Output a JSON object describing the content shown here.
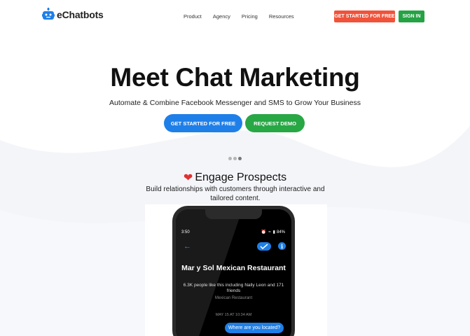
{
  "brand": {
    "name": "eChatbots"
  },
  "nav": {
    "items": [
      "Product",
      "Agency",
      "Pricing",
      "Resources"
    ]
  },
  "header": {
    "cta_label": "GET STARTED FOR FREE",
    "signin_label": "SIGN IN"
  },
  "hero": {
    "title": "Meet Chat Marketing",
    "subtitle": "Automate & Combine Facebook Messenger and SMS to Grow Your Business",
    "primary_cta": "GET STARTED FOR FREE",
    "secondary_cta": "REQUEST DEMO"
  },
  "carousel": {
    "dots": 3,
    "active": 2
  },
  "section": {
    "title": "Engage Prospects",
    "description": "Build relationships with customers through interactive and tailored content."
  },
  "phone": {
    "time": "3:50",
    "battery": "84%",
    "page_name": "Mar y Sol Mexican Restaurant",
    "likes": "6.3K people like this including Nally Leon and 171 friends",
    "category": "Mexican Restaurant",
    "message_time": "MAY 15 AT 10:34 AM",
    "message": "Where are you located?"
  },
  "colors": {
    "orange": "#f0533a",
    "green": "#28a745",
    "blue": "#1f7fe8",
    "heart": "#e03131"
  },
  "icons": [
    "robot-logo-icon",
    "heart-icon",
    "back-arrow-icon",
    "toggle-icon",
    "info-icon",
    "wifi-icon",
    "battery-icon"
  ]
}
